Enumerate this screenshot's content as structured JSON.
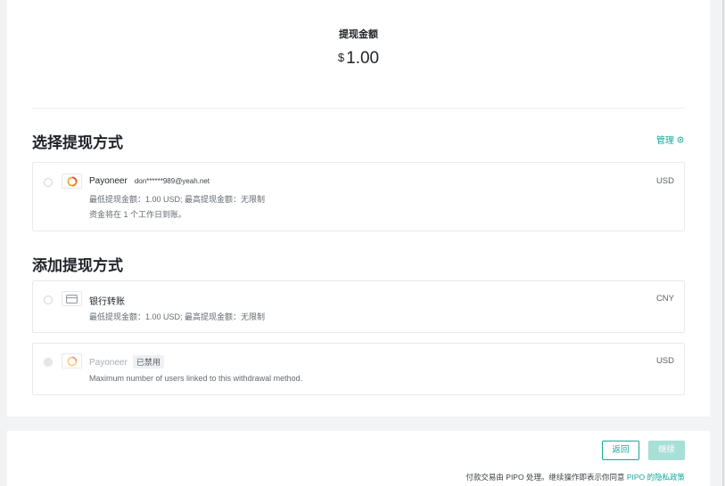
{
  "withdraw": {
    "amount_label": "提现金额",
    "currency_symbol": "$",
    "amount": "1.00"
  },
  "select_section": {
    "title": "选择提现方式",
    "manage_label": "管理",
    "methods": [
      {
        "name": "Payoneer",
        "account": "don******989@yeah.net",
        "limits": "最低提现金额：1.00 USD; 最高提现金额：无限制",
        "arrival": "资金将在 1 个工作日到账。",
        "currency": "USD",
        "icon": "payoneer-logo"
      }
    ]
  },
  "add_section": {
    "title": "添加提现方式",
    "methods": [
      {
        "name": "银行转账",
        "limits": "最低提现金额：1.00 USD; 最高提现金额：无限制",
        "currency": "CNY",
        "icon": "bank-card-icon"
      },
      {
        "name": "Payoneer",
        "badge": "已禁用",
        "note": "Maximum number of users linked to this withdrawal method.",
        "currency": "USD",
        "icon": "payoneer-logo"
      }
    ]
  },
  "footer": {
    "back_label": "返回",
    "continue_label": "继续",
    "terms_prefix": "付款交易由 PIPO 处理。继续操作即表示你同意 ",
    "terms_link": "PIPO 的隐私政策"
  },
  "colors": {
    "accent": "#14a89a",
    "accent_disabled": "#a8dfd6",
    "background": "#f2f3f5"
  }
}
